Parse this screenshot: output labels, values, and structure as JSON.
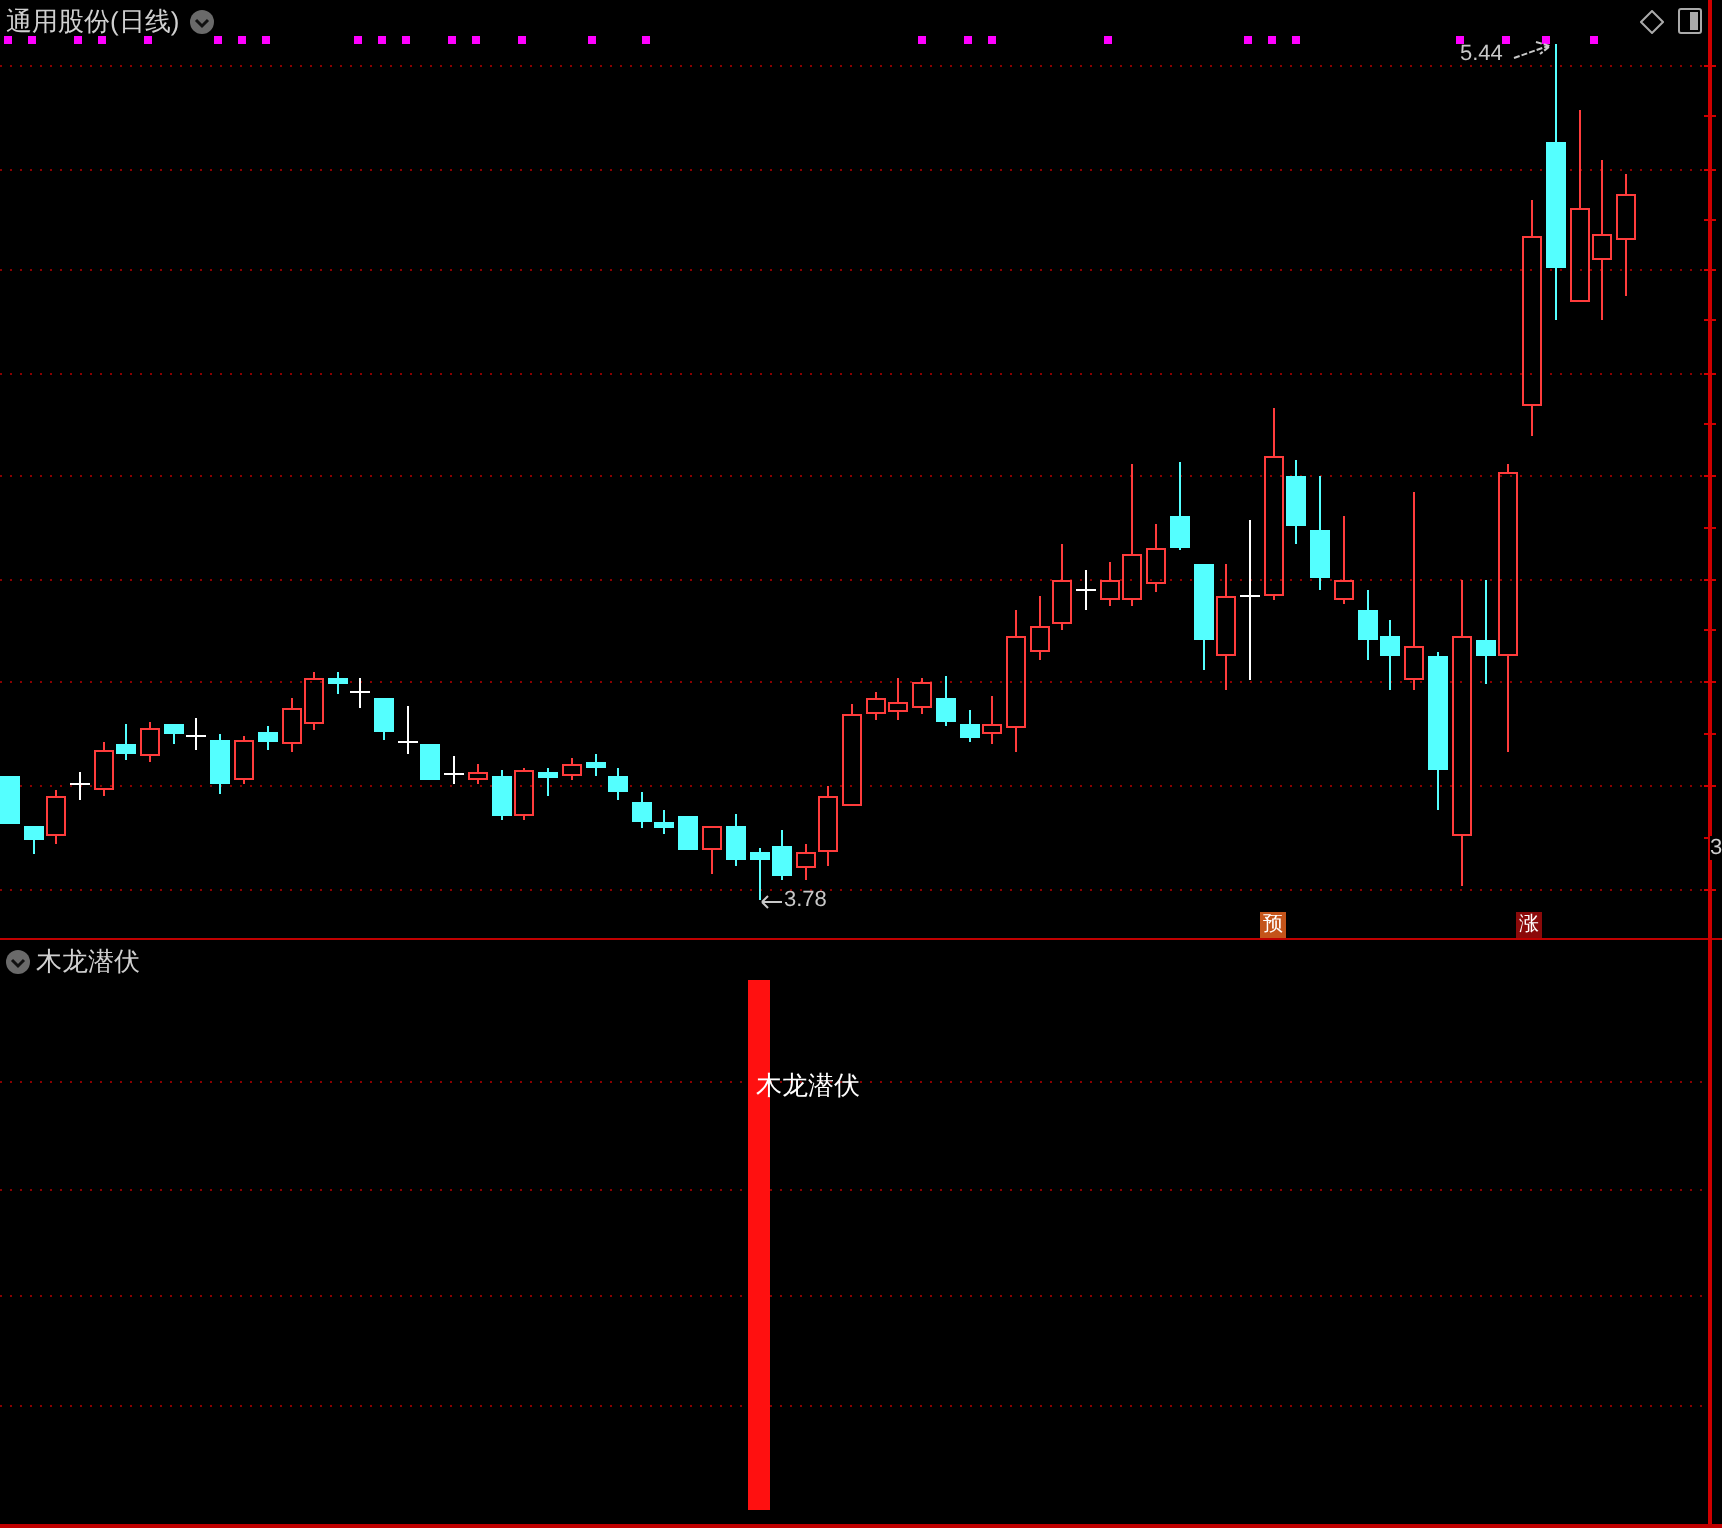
{
  "chart_title": "通用股份(日线)",
  "price_chart": {
    "high_label": "5.44",
    "low_label": "3.78",
    "axis_label": "3",
    "markers": [
      {
        "text": "预",
        "color": "#c4541a"
      },
      {
        "text": "涨",
        "color": "#8b0a0a"
      }
    ]
  },
  "indicator": {
    "title": "木龙潜伏",
    "signal_label": "木龙潜伏"
  }
}
